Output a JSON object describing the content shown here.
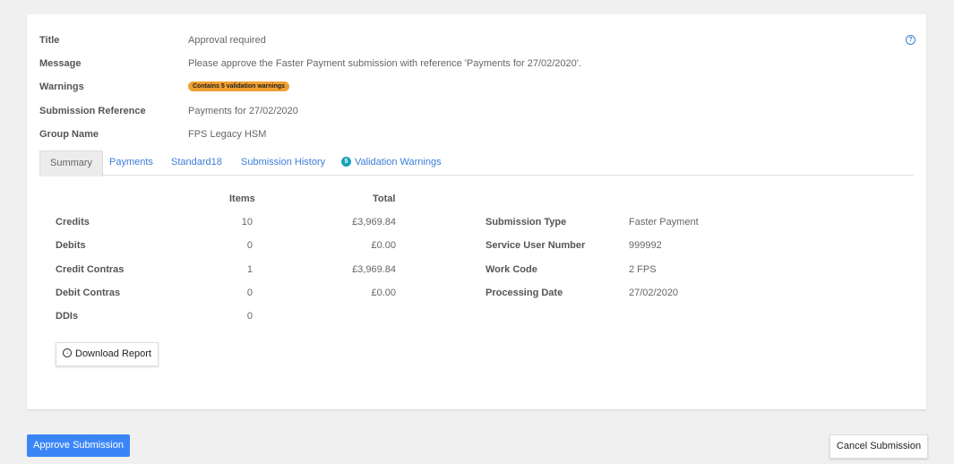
{
  "info": {
    "title_label": "Title",
    "title_value": "Approval required",
    "message_label": "Message",
    "message_value": "Please approve the Faster Payment submission with reference 'Payments for 27/02/2020'.",
    "warnings_label": "Warnings",
    "warnings_badge": "Contains 5 validation warnings",
    "ref_label": "Submission Reference",
    "ref_value": "Payments for 27/02/2020",
    "group_label": "Group Name",
    "group_value": "FPS Legacy HSM",
    "help_icon": "question-circle-icon",
    "help_glyph": "?"
  },
  "tabs": [
    {
      "label": "Summary",
      "active": true
    },
    {
      "label": "Payments"
    },
    {
      "label": "Standard18"
    },
    {
      "label": "Submission History"
    },
    {
      "label": "Validation Warnings",
      "count": "5"
    }
  ],
  "summary": {
    "items_header": "Items",
    "total_header": "Total",
    "rows": [
      {
        "label": "Credits",
        "items": "10",
        "total": "£3,969.84"
      },
      {
        "label": "Debits",
        "items": "0",
        "total": "£0.00"
      },
      {
        "label": "Credit Contras",
        "items": "1",
        "total": "£3,969.84"
      },
      {
        "label": "Debit Contras",
        "items": "0",
        "total": "£0.00"
      },
      {
        "label": "DDIs",
        "items": "0",
        "total": ""
      }
    ]
  },
  "details": [
    {
      "label": "Submission Type",
      "value": "Faster Payment"
    },
    {
      "label": "Service User Number",
      "value": "999992"
    },
    {
      "label": "Work Code",
      "value": "2 FPS"
    },
    {
      "label": "Processing Date",
      "value": "27/02/2020"
    }
  ],
  "actions": {
    "download_label": "Download Report",
    "download_icon": "download-circle-icon",
    "download_glyph": "↓",
    "approve_label": "Approve Submission",
    "cancel_label": "Cancel Submission"
  },
  "colors": {
    "link": "#3b7dd8",
    "primary_button": "#3b86f7",
    "warning_badge": "#f0a030",
    "tab_count_badge": "#17a2b8"
  }
}
